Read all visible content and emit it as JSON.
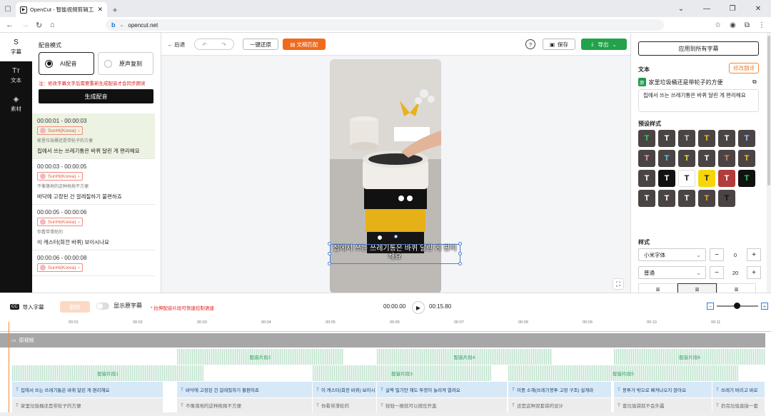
{
  "browser": {
    "tab_title": "OpenCut - 智能视频剪辑工具",
    "url": "opencut.net",
    "nav": {
      "back": "←",
      "forward": "→",
      "reload": "↻",
      "home": "⌂"
    }
  },
  "rail": {
    "items": [
      {
        "icon": "S",
        "label": "字幕",
        "active": true
      },
      {
        "icon": "Tт",
        "label": "文本",
        "active": false
      },
      {
        "icon": "◈",
        "label": "素材",
        "active": false
      }
    ]
  },
  "left": {
    "section_title": "配音模式",
    "modes": [
      {
        "label": "AI配音",
        "selected": true
      },
      {
        "label": "原声复刻",
        "selected": false
      }
    ],
    "warning": "注：修改字幕文字后需要重新生成配音才会同步朗读",
    "generate_label": "生成配音",
    "segments": [
      {
        "time": "00:00:01 - 00:00:03",
        "voice": "SunHi(Korea)",
        "cn": "家里垃圾桶还是带轮子的方便",
        "ko": "집에서 쓰는 쓰레기통은 바퀴 달린 게 편리해요",
        "active": true
      },
      {
        "time": "00:00:03 - 00:00:05",
        "voice": "SunHi(Korea)",
        "cn": "不像落地的这种拖拖不方便",
        "ko": "바닥에 고정된 건 걸레질하기 불편하죠",
        "active": false
      },
      {
        "time": "00:00:05 - 00:00:06",
        "voice": "SunHi(Korea)",
        "cn": "你看带滑轮的",
        "ko": "이 캐스터(회전 바퀴) 보이시나요",
        "active": false
      },
      {
        "time": "00:00:06 - 00:00:08",
        "voice": "SunHi(Korea)",
        "cn": "",
        "ko": "",
        "active": false
      }
    ]
  },
  "toolbar": {
    "back_label": "← 后退",
    "undo": "↶",
    "redo": "↷",
    "reset_label": "一键还原",
    "match_label": "文稿匹配",
    "help": "?",
    "save_label": "保存",
    "export_label": "导出"
  },
  "preview": {
    "subtitle": "집에서 쓰는 쓰레기통은 바퀴 달린 게 편리해요"
  },
  "right": {
    "apply_all_label": "应用到所有字幕",
    "text_title": "文本",
    "modify_translate_label": "修改翻译",
    "source_tag": "原",
    "source_text": "家里垃圾桶还是带轮子的方便",
    "translated_text": "집에서 쓰는 쓰레기통은 바퀴 달린 게 편리해요",
    "preset_title": "预设样式",
    "presets": [
      {
        "bg": "#4a4444",
        "fg": "#2bd46a",
        "t": "T"
      },
      {
        "bg": "#4a4444",
        "fg": "#ffffff",
        "t": "T"
      },
      {
        "bg": "#4a4444",
        "fg": "#cfcfcf",
        "t": "T"
      },
      {
        "bg": "#4a4444",
        "fg": "#f5c518",
        "t": "T"
      },
      {
        "bg": "#4a4444",
        "fg": "#ffffff",
        "t": "T"
      },
      {
        "bg": "#4a4444",
        "fg": "#9fc7ff",
        "t": "T"
      },
      {
        "bg": "#4a4444",
        "fg": "#f4a0b0",
        "t": "T"
      },
      {
        "bg": "#4a4444",
        "fg": "#5cc8f0",
        "t": "T"
      },
      {
        "bg": "#4a4444",
        "fg": "#e8e04a",
        "t": "T"
      },
      {
        "bg": "#4a4444",
        "fg": "#ffffff",
        "t": "T"
      },
      {
        "bg": "#4a4444",
        "fg": "#e58a6a",
        "t": "T"
      },
      {
        "bg": "#4a4444",
        "fg": "#f5c518",
        "t": "T"
      },
      {
        "bg": "#4a4444",
        "fg": "#ffffff",
        "t": "T"
      },
      {
        "bg": "#111111",
        "fg": "#ffffff",
        "t": "T"
      },
      {
        "bg": "#ffffff",
        "fg": "#111111",
        "t": "T"
      },
      {
        "bg": "#f5d60a",
        "fg": "#111111",
        "t": "T"
      },
      {
        "bg": "#b23b3b",
        "fg": "#ffffff",
        "t": "T"
      },
      {
        "bg": "#111111",
        "fg": "#2bd46a",
        "t": "T"
      },
      {
        "bg": "#4a4444",
        "fg": "#ffffff",
        "t": "T"
      },
      {
        "bg": "#4a4444",
        "fg": "#ffffff",
        "t": "T"
      },
      {
        "bg": "#4a4444",
        "fg": "#ffffff",
        "t": "T"
      },
      {
        "bg": "#4a4444",
        "fg": "#f5a623",
        "t": "T"
      },
      {
        "bg": "#4a4444",
        "fg": "#111111",
        "t": "T"
      }
    ],
    "style_title": "样式",
    "font": "小米字体",
    "letter_spacing": "0",
    "weight": "普通",
    "font_size": "20"
  },
  "timeline": {
    "import_label": "导入字幕",
    "disabled_btn_label": "删除",
    "show_original_label": "显示原字幕",
    "hint": "* 拉伸配音片段可快速控制语速",
    "current_time": "00:00.00",
    "total_time": "00:15.80",
    "ticks": [
      "00:01",
      "00:02",
      "00:03",
      "00:04",
      "00:05",
      "00:06",
      "00:07",
      "00:08",
      "00:09",
      "00:10",
      "00:11"
    ],
    "video_track_label": "原视频",
    "audio_upper": [
      {
        "label": "配音片段2"
      },
      {
        "label": "配音片段4"
      },
      {
        "label": "配音片段6"
      }
    ],
    "audio_lower": [
      {
        "label": "配音片段1"
      },
      {
        "label": "配音片段3"
      },
      {
        "label": "配音片段5"
      }
    ],
    "subs": [
      {
        "text": "집에서 쓰는 쓰레기통은 바퀴 달린 게 편리해요"
      },
      {
        "text": "바닥에 고정된 건 걸레질하기 불편하죠"
      },
      {
        "text": "이 캐스터(회전 바퀴) 보이시"
      },
      {
        "text": "살짝 밀기만 해도 뚜껑이 눌러져 열려요"
      },
      {
        "text": "이중 소재(쓰레기봉투 고정 구조) 설계라"
      },
      {
        "text": "봉투가 밖으로 삐져나오지 않아요"
      },
      {
        "text": "쓰레기 버리고 바로"
      }
    ],
    "origs": [
      {
        "text": "家里垃圾桶还是带轮子的方便"
      },
      {
        "text": "不像落地的这种拖拖不方便"
      },
      {
        "text": "你看带滑轮的"
      },
      {
        "text": "轻轻一推就可以按压开盖"
      },
      {
        "text": "还是这种双套袋的设计"
      },
      {
        "text": "套垃圾袋就不会外露"
      },
      {
        "text": "扔完垃圾直接一套"
      }
    ]
  }
}
